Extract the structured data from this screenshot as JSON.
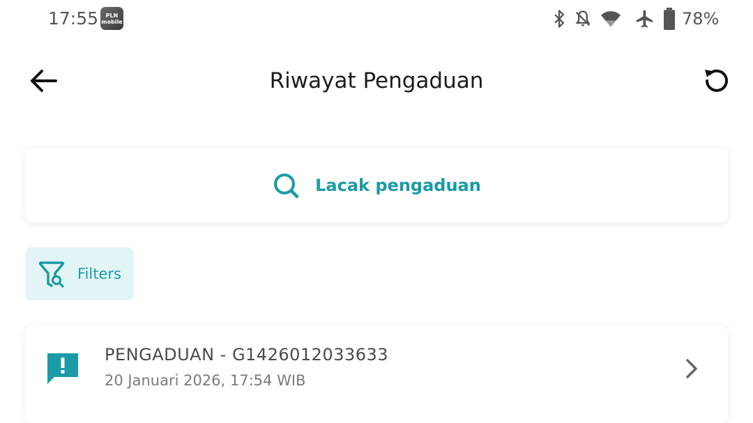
{
  "status_bar": {
    "time": "17:55",
    "app_badge_line1": "PLN",
    "app_badge_line2": "mobile",
    "battery_percent": "78%",
    "icons": [
      "bluetooth-icon",
      "notifications-off-icon",
      "wifi-icon",
      "airplane-icon",
      "battery-icon"
    ]
  },
  "app_bar": {
    "title": "Riwayat Pengaduan",
    "back_icon": "arrow-left-icon",
    "refresh_icon": "refresh-icon"
  },
  "search": {
    "label": "Lacak pengaduan",
    "icon": "search-icon"
  },
  "filters": {
    "label": "Filters",
    "icon": "filter-search-icon"
  },
  "complaints": [
    {
      "title": "PENGADUAN - G1426012033633",
      "date": "20 Januari 2026, 17:54 WIB",
      "icon": "alert-message-icon"
    }
  ],
  "colors": {
    "accent": "#1a9ba5",
    "filter_bg": "#e3f4f6",
    "text_primary": "#1c1c1c",
    "text_secondary": "#7a7a7a"
  }
}
